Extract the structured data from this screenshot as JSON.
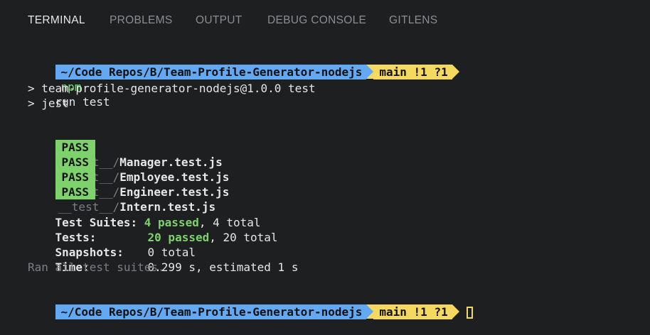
{
  "tabs": [
    {
      "label": "TERMINAL",
      "active": true
    },
    {
      "label": "PROBLEMS",
      "active": false
    },
    {
      "label": "OUTPUT",
      "active": false
    },
    {
      "label": "DEBUG CONSOLE",
      "active": false
    },
    {
      "label": "GITLENS",
      "active": false
    }
  ],
  "prompt": {
    "path": "~/Code Repos/B/Team-Profile-Generator-nodejs",
    "git": "main !1 ?1"
  },
  "command": {
    "program": "npm",
    "args": "run test"
  },
  "npm_output": [
    "> team-profile-generator-nodejs@1.0.0 test",
    "> jest"
  ],
  "results": [
    {
      "status": "PASS",
      "dir": "__test__/",
      "file": "Manager.test.js"
    },
    {
      "status": "PASS",
      "dir": "__test__/",
      "file": "Employee.test.js"
    },
    {
      "status": "PASS",
      "dir": "__test__/",
      "file": "Engineer.test.js"
    },
    {
      "status": "PASS",
      "dir": "__test__/",
      "file": "Intern.test.js"
    }
  ],
  "summary": {
    "suites_label": "Test Suites:",
    "suites_passed": "4 passed",
    "suites_total": ", 4 total",
    "tests_label": "Tests:",
    "tests_passed": "20 passed",
    "tests_total": ", 20 total",
    "snapshots_label": "Snapshots:",
    "snapshots_value": "0 total",
    "time_label": "Time:",
    "time_value": "0.299 s, estimated 1 s",
    "footer": "Ran all test suites."
  },
  "colors": {
    "background": "#1e1f21",
    "path_segment": "#62a8f2",
    "git_segment": "#f5d85f",
    "pass_badge": "#7ed26b",
    "npm_command": "#6fdc6f"
  }
}
